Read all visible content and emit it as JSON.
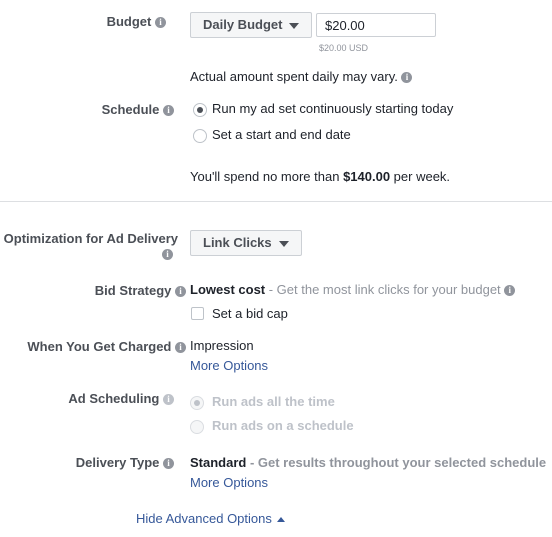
{
  "budget": {
    "label": "Budget",
    "type_value": "Daily Budget",
    "amount": "$20.00",
    "amount_note": "$20.00 USD",
    "note": "Actual amount spent daily may vary."
  },
  "schedule": {
    "label": "Schedule",
    "options": [
      {
        "label": "Run my ad set continuously starting today",
        "selected": true
      },
      {
        "label": "Set a start and end date",
        "selected": false
      }
    ],
    "spend_prefix": "You'll spend no more than ",
    "spend_amount": "$140.00",
    "spend_suffix": " per week."
  },
  "optimization": {
    "label": "Optimization for Ad Delivery",
    "value": "Link Clicks"
  },
  "bid_strategy": {
    "label": "Bid Strategy",
    "value": "Lowest cost",
    "description": " - Get the most link clicks for your budget",
    "bid_cap_label": "Set a bid cap"
  },
  "charged": {
    "label": "When You Get Charged",
    "value": "Impression",
    "more_options": "More Options"
  },
  "ad_scheduling": {
    "label": "Ad Scheduling",
    "options": [
      {
        "label": "Run ads all the time",
        "selected": true
      },
      {
        "label": "Run ads on a schedule",
        "selected": false
      }
    ]
  },
  "delivery_type": {
    "label": "Delivery Type",
    "value": "Standard",
    "description": " - Get results throughout your selected schedule",
    "more_options": "More Options"
  },
  "hide_advanced": "Hide Advanced Options",
  "colors": {
    "link": "#365899",
    "label": "#4b4f56",
    "muted": "#90949c",
    "disabled": "#bec2c9"
  },
  "icons": {
    "info": "info-icon",
    "dropdown": "caret-down-icon",
    "collapse": "caret-up-icon"
  }
}
